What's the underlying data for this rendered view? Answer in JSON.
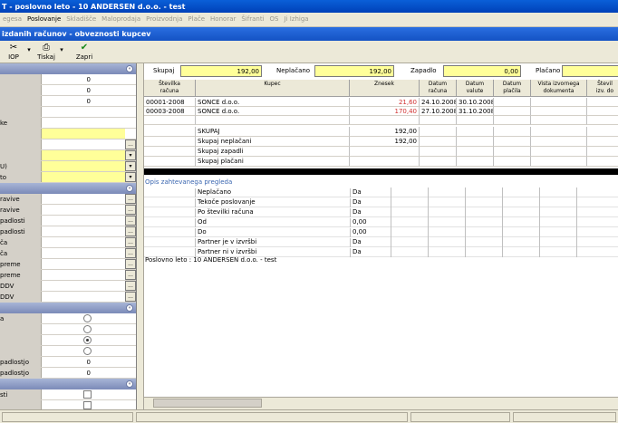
{
  "window": {
    "title": "T - poslovno leto - 10 ANDERSEN d.o.o. - test"
  },
  "menu": [
    {
      "label": "egesa",
      "enabled": false
    },
    {
      "label": "Poslovanje",
      "enabled": true
    },
    {
      "label": "Skladišče",
      "enabled": false
    },
    {
      "label": "Maloprodaja",
      "enabled": false
    },
    {
      "label": "Proizvodnja",
      "enabled": false
    },
    {
      "label": "Plače",
      "enabled": false
    },
    {
      "label": "Honorar",
      "enabled": false
    },
    {
      "label": "Šifranti",
      "enabled": false
    },
    {
      "label": "OS",
      "enabled": false
    },
    {
      "label": "Ji Izhiga",
      "enabled": false
    }
  ],
  "subtitle": "izdanih računov - obveznosti kupcev",
  "toolbar": {
    "iop": {
      "label": "IOP",
      "icon": "scissors-x-icon"
    },
    "tiskaj": {
      "label": "Tiskaj",
      "icon": "printer-icon"
    },
    "zapri": {
      "label": "Zapri",
      "icon": "checkmark-icon"
    }
  },
  "left": {
    "rows1": [
      {
        "label": "",
        "value": "0"
      },
      {
        "label": "",
        "value": "0"
      },
      {
        "label": "",
        "value": "0"
      },
      {
        "label": "",
        "value": ""
      },
      {
        "label": "ke",
        "value": ""
      }
    ],
    "rows1b": [
      {
        "label": "",
        "value": "",
        "yellow": true,
        "btn": ""
      },
      {
        "label": "",
        "value": "",
        "yellow": false,
        "btn": "..."
      },
      {
        "label": "",
        "value": "",
        "yellow": true,
        "btn": "▾"
      },
      {
        "label": "U)",
        "value": "",
        "yellow": true,
        "btn": "▾"
      },
      {
        "label": "to",
        "value": "",
        "yellow": true,
        "btn": "▾"
      }
    ],
    "rows2": [
      {
        "label": "ravive"
      },
      {
        "label": "ravive"
      },
      {
        "label": "padlosti"
      },
      {
        "label": "padlosti"
      },
      {
        "label": "ča"
      },
      {
        "label": "ča"
      },
      {
        "label": "preme"
      },
      {
        "label": "preme"
      },
      {
        "label": "DDV"
      },
      {
        "label": "DDV"
      }
    ],
    "rows3": [
      {
        "label": "a",
        "radio": false
      },
      {
        "label": "",
        "radio": false
      },
      {
        "label": "",
        "radio": true
      },
      {
        "label": "",
        "radio": false
      }
    ],
    "rows3b": [
      {
        "label": "padlostjo",
        "value": "0"
      },
      {
        "label": "padlostjo",
        "value": "0"
      }
    ],
    "rows4": [
      {
        "label": "sti"
      },
      {
        "label": ""
      }
    ]
  },
  "summary": {
    "skupaj_label": "Skupaj",
    "skupaj": "192,00",
    "neplacano_label": "Neplačano",
    "neplacano": "192,00",
    "zapadlo_label": "Zapadlo",
    "zapadlo": "0,00",
    "placano_label": "Plačano",
    "placano": ""
  },
  "grid": {
    "headers": [
      "Številka\nračuna",
      "Kupec",
      "Znesek",
      "Datum\nračuna",
      "Datum\nvalute",
      "Datum\nplačila",
      "Vista izvornega\ndokumenta",
      "Števil\nizv. do"
    ],
    "rows": [
      {
        "stevilka": "00001-2008",
        "kupec": "SONCE d.o.o.",
        "znesek": "21,60",
        "datum_racuna": "24.10.2008",
        "datum_valute": "30.10.2008"
      },
      {
        "stevilka": "00003-2008",
        "kupec": "SONCE d.o.o.",
        "znesek": "170,40",
        "datum_racuna": "27.10.2008",
        "datum_valute": "31.10.2008"
      }
    ],
    "totals": [
      {
        "label": "SKUPAJ",
        "value": "192,00"
      },
      {
        "label": "Skupaj neplačani",
        "value": "192,00"
      },
      {
        "label": "Skupaj zapadli",
        "value": ""
      },
      {
        "label": "Skupaj plačani",
        "value": ""
      }
    ]
  },
  "opis": {
    "title": "Opis zahtevanega pregleda",
    "rows": [
      {
        "key": "Neplačano",
        "value": "Da"
      },
      {
        "key": "Tekoče poslovanje",
        "value": "Da"
      },
      {
        "key": "Po številki računa",
        "value": "Da"
      },
      {
        "key": "Od",
        "value": "0,00"
      },
      {
        "key": "Do",
        "value": "0,00"
      },
      {
        "key": "Partner je v izvršbi",
        "value": "Da"
      },
      {
        "key": "Partner ni v izvršbi",
        "value": "Da"
      }
    ],
    "footer": "Poslovno leto : 10   ANDERSEN d.o.o. - test"
  }
}
